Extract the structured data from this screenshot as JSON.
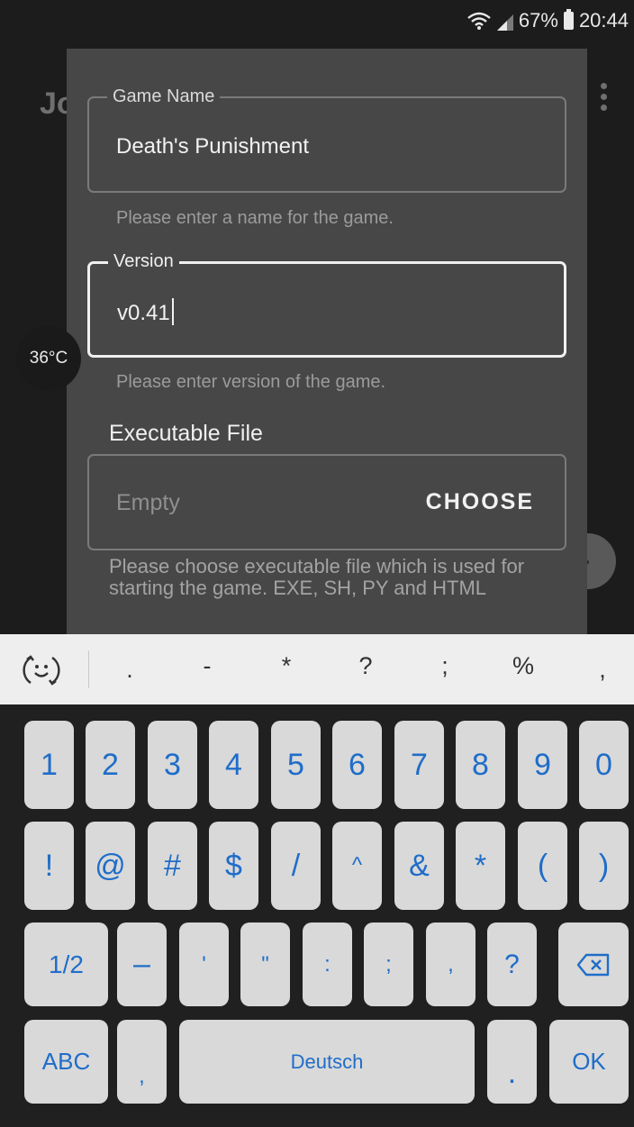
{
  "status_bar": {
    "battery_percent": "67%",
    "time": "20:44",
    "icons": [
      "wifi-icon",
      "signal-icon",
      "battery-icon"
    ]
  },
  "background_app": {
    "title_fragment": "Jo",
    "temperature_badge": "36°C"
  },
  "dialog": {
    "game_name": {
      "label": "Game Name",
      "value": "Death's Punishment",
      "helper": "Please enter a name for the game."
    },
    "version": {
      "label": "Version",
      "value": "v0.41",
      "helper": "Please enter version of the game."
    },
    "executable": {
      "section_label": "Executable File",
      "placeholder": "Empty",
      "button_label": "CHOOSE",
      "helper": "Please choose executable file which is used for starting the game. EXE, SH, PY and HTML"
    }
  },
  "keyboard": {
    "symbol_bar": [
      ".",
      "-",
      "*",
      "?",
      ";",
      "%",
      ","
    ],
    "row1": [
      "1",
      "2",
      "3",
      "4",
      "5",
      "6",
      "7",
      "8",
      "9",
      "0"
    ],
    "row2": [
      "!",
      "@",
      "#",
      "$",
      "/",
      "^",
      "&",
      "*",
      "(",
      ")"
    ],
    "row3": [
      "1/2",
      "–",
      "'",
      "\"",
      ":",
      ";",
      ",",
      "?"
    ],
    "row4": {
      "abc": "ABC",
      "comma": ",",
      "space": "Deutsch",
      "period": ".",
      "ok": "OK"
    },
    "colors": {
      "key_text": "#1f6dc9",
      "key_bg": "#d9d9d9",
      "bg": "#202020"
    }
  }
}
